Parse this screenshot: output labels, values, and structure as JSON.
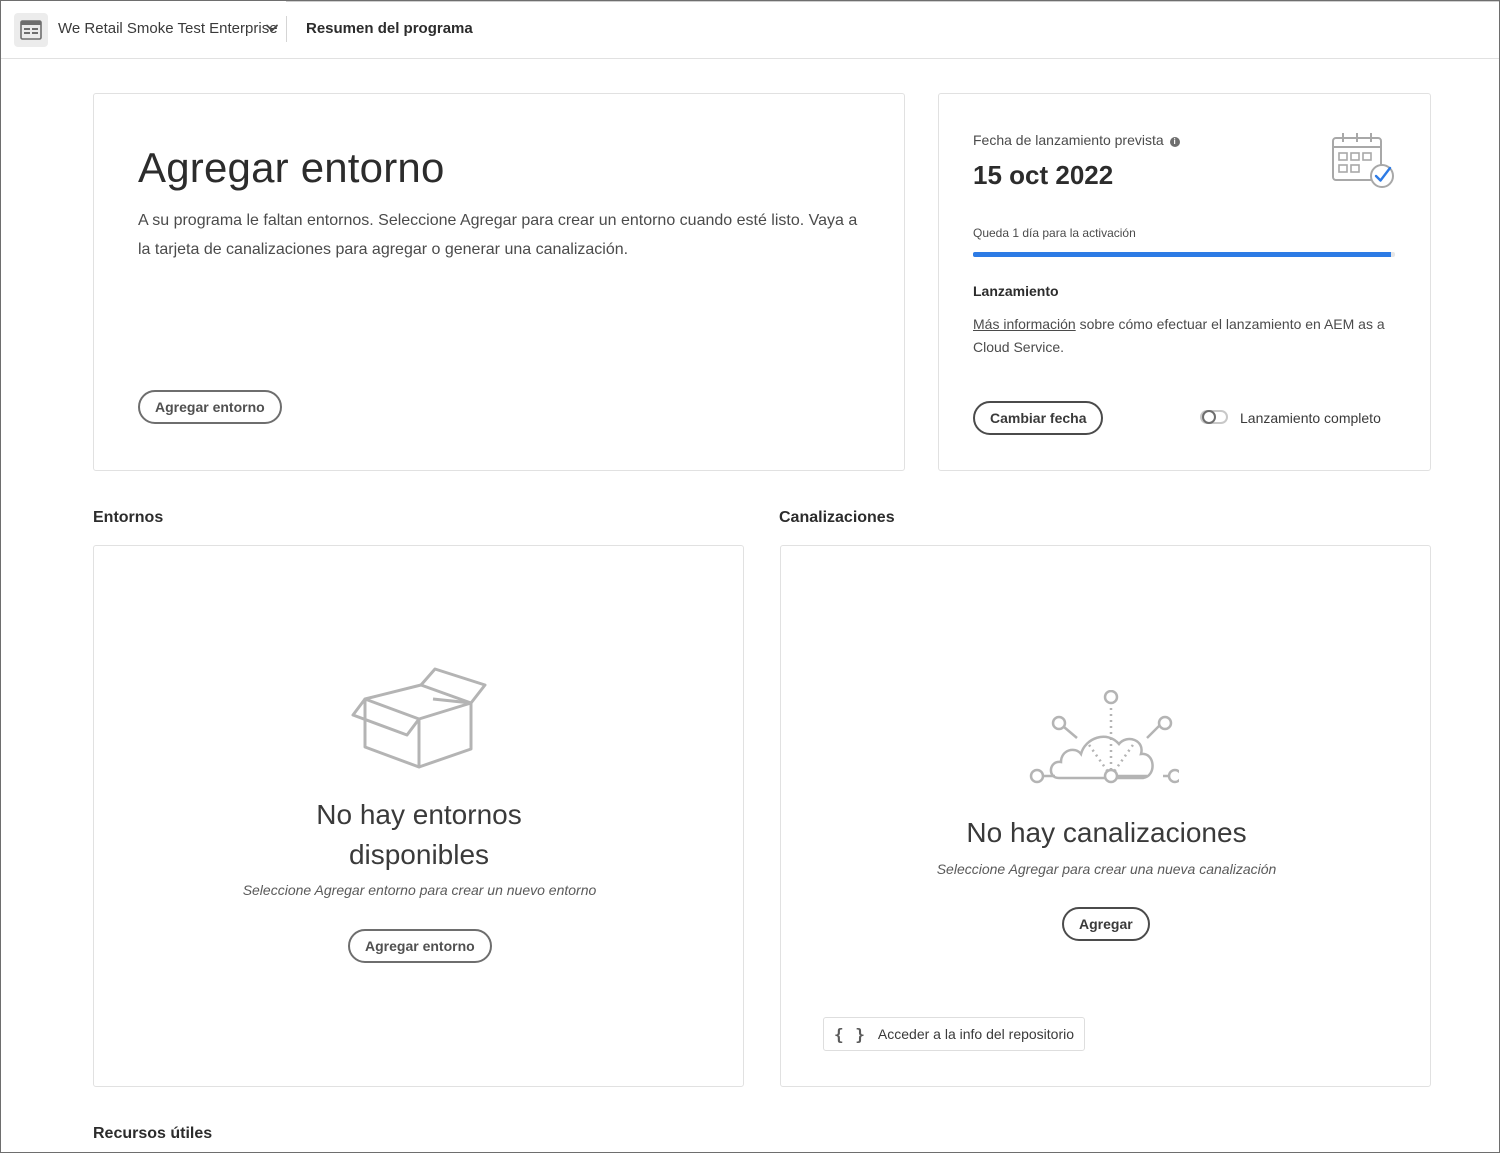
{
  "header": {
    "program_name": "We Retail Smoke Test Enterprise",
    "page_title": "Resumen del programa"
  },
  "add_environment_card": {
    "title": "Agregar entorno",
    "description": "A su programa le faltan entornos. Seleccione Agregar para crear un entorno cuando esté listo. Vaya a la tarjeta de canalizaciones para agregar o generar una canalización.",
    "button_label": "Agregar entorno"
  },
  "golive_card": {
    "label": "Fecha de lanzamiento prevista",
    "info_glyph": "i",
    "date": "15 oct 2022",
    "remaining": "Queda 1 día para la activación",
    "progress": 0.99,
    "progress_color": "#2d7be5",
    "section_title": "Lanzamiento",
    "learn_more_link": "Más información",
    "learn_more_text": " sobre cómo efectuar el lanzamiento en AEM as a Cloud Service.",
    "change_date_button": "Cambiar fecha",
    "golive_toggle_label": "Lanzamiento completo",
    "golive_toggle_on": false
  },
  "environments": {
    "heading": "Entornos",
    "empty_title": "No hay entornos disponibles",
    "empty_subtitle": "Seleccione Agregar entorno para crear un nuevo entorno",
    "button_label": "Agregar entorno"
  },
  "pipelines": {
    "heading": "Canalizaciones",
    "empty_title": "No hay canalizaciones",
    "empty_subtitle": "Seleccione Agregar para crear una nueva canalización",
    "button_label": "Agregar",
    "repo_link_glyph": "{ }",
    "repo_link_label": "Acceder a la info del repositorio"
  },
  "resources": {
    "heading": "Recursos útiles"
  }
}
